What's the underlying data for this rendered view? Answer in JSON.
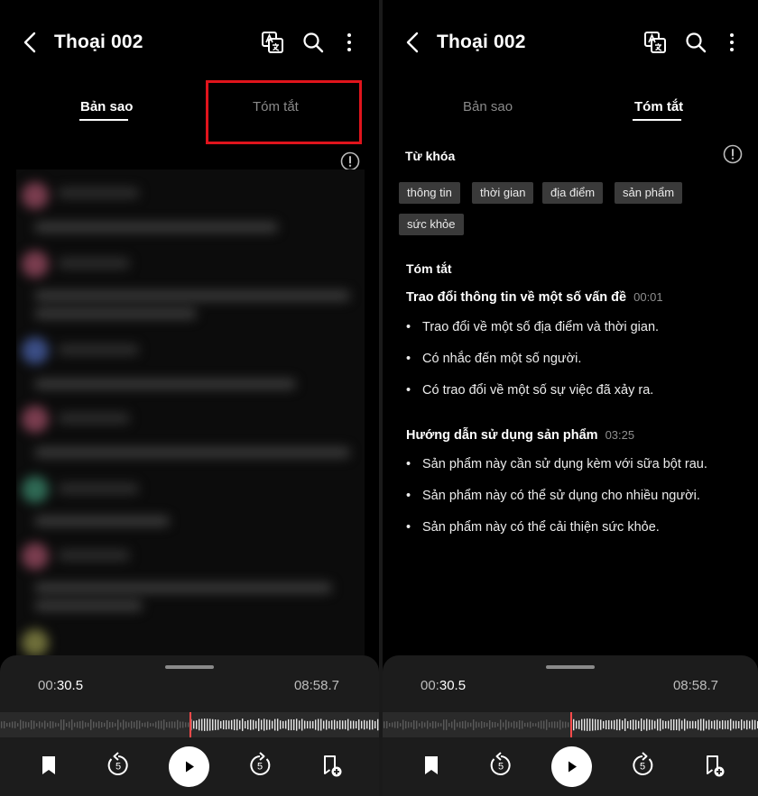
{
  "screens": [
    {
      "title": "Thoại 002",
      "tabs": [
        "Bản sao",
        "Tóm tắt"
      ],
      "active_tab": 0,
      "player": {
        "current_min": "00:",
        "current_sec": "30.5",
        "total": "08:58.7",
        "progress": 0.5
      }
    },
    {
      "title": "Thoại 002",
      "tabs": [
        "Bản sao",
        "Tóm tắt"
      ],
      "active_tab": 1,
      "summary": {
        "keywords_label": "Từ khóa",
        "keywords": [
          "thông tin",
          "thời gian",
          "địa điểm",
          "sản phẩm",
          "sức khỏe"
        ],
        "summary_label": "Tóm tắt",
        "topics": [
          {
            "title": "Trao đổi thông tin về một số vấn đề",
            "time": "00:01",
            "bullets": [
              "Trao đổi về một số địa điểm và thời gian.",
              "Có nhắc đến một số người.",
              "Có trao đổi về một số sự việc đã xảy ra."
            ]
          },
          {
            "title": "Hướng dẫn sử dụng sản phẩm",
            "time": "03:25",
            "bullets": [
              "Sản phẩm này cần sử dụng kèm với sữa bột rau.",
              "Sản phẩm này có thể sử dụng cho nhiều người.",
              "Sản phẩm này có thể cải thiện sức khỏe."
            ]
          }
        ]
      },
      "player": {
        "current_min": "00:",
        "current_sec": "30.5",
        "total": "08:58.7",
        "progress": 0.5
      }
    }
  ],
  "skip_seconds": "5",
  "colors": {
    "accent_red": "#e0141c",
    "playhead": "#ff4a4a",
    "background": "#000000",
    "player_bg": "#1c1c1c"
  },
  "icons": [
    "back-arrow-icon",
    "translate-icon",
    "search-icon",
    "more-vertical-icon",
    "info-icon",
    "bookmark-icon",
    "rewind-5-icon",
    "play-icon",
    "forward-5-icon",
    "add-bookmark-icon"
  ]
}
